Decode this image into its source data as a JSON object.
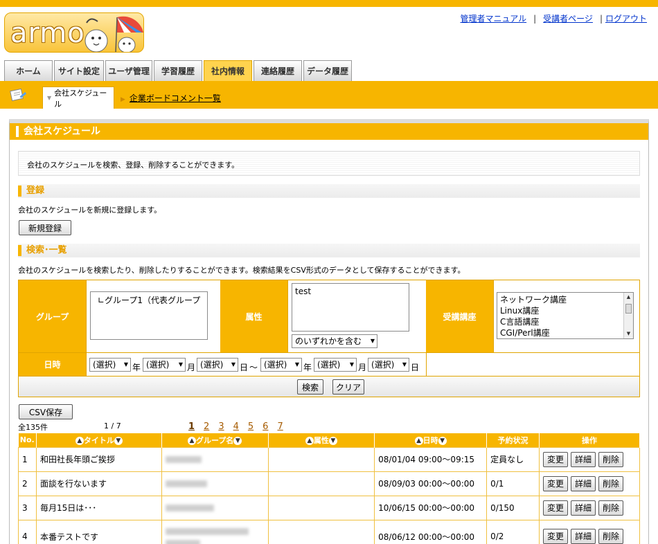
{
  "header": {
    "logo_text": "armo",
    "links": [
      "管理者マニュアル",
      "受講者ページ",
      "ログアウト"
    ]
  },
  "tabs": [
    {
      "label": "ホーム",
      "active": false
    },
    {
      "label": "サイト設定",
      "active": false
    },
    {
      "label": "ユーザ管理",
      "active": false
    },
    {
      "label": "学習履歴",
      "active": false
    },
    {
      "label": "社内情報",
      "active": true
    },
    {
      "label": "連絡履歴",
      "active": false
    },
    {
      "label": "データ履歴",
      "active": false
    }
  ],
  "subnav": {
    "active_label": "会社スケジュール",
    "link_label": "企業ボードコメント一覧"
  },
  "panel": {
    "title": "会社スケジュール",
    "description": "会社のスケジュールを検索、登録、削除することができます。"
  },
  "register": {
    "heading": "登録",
    "text": "会社のスケジュールを新規に登録します。",
    "button": "新規登録"
  },
  "search": {
    "heading": "検索･一覧",
    "text": "会社のスケジュールを検索したり、削除したりすることができます。検索結果をCSV形式のデータとして保存することができます。",
    "group_label": "グループ",
    "group_option": "∟グループ1（代表グループ",
    "attr_label": "属性",
    "attr_value": "test",
    "attr_mode": "のいずれかを含む",
    "course_label": "受講講座",
    "courses": [
      "ネットワーク講座",
      "Linux講座",
      "C言語講座",
      "CGI/Perl講座"
    ],
    "date_label": "日時",
    "select_placeholder": "(選択)",
    "unit_year": "年",
    "unit_month": "月",
    "unit_day": "日",
    "tilde": "～",
    "search_button": "検索",
    "clear_button": "クリア"
  },
  "results": {
    "csv_button": "CSV保存",
    "total": "全135件",
    "page_info": "1 / 7",
    "pages": [
      "1",
      "2",
      "3",
      "4",
      "5",
      "6",
      "7"
    ],
    "columns": [
      "No.",
      "タイトル",
      "グループ名",
      "属性",
      "日時",
      "予約状況",
      "操作"
    ],
    "action_labels": [
      "変更",
      "詳細",
      "削除"
    ],
    "rows": [
      {
        "no": "1",
        "title": "和田社長年頭ご挨拶",
        "date": "08/01/04 09:00～09:15",
        "status": "定員なし"
      },
      {
        "no": "2",
        "title": "面談を行ないます",
        "date": "08/09/03 00:00～00:00",
        "status": "0/1"
      },
      {
        "no": "3",
        "title": "毎月15日は･･･",
        "date": "10/06/15 00:00～00:00",
        "status": "0/150"
      },
      {
        "no": "4",
        "title": "本番テストです",
        "date": "08/06/12 00:00～00:00",
        "status": "0/2"
      }
    ]
  },
  "colors": {
    "accent": "#f7b500",
    "link": "#0033cc"
  }
}
